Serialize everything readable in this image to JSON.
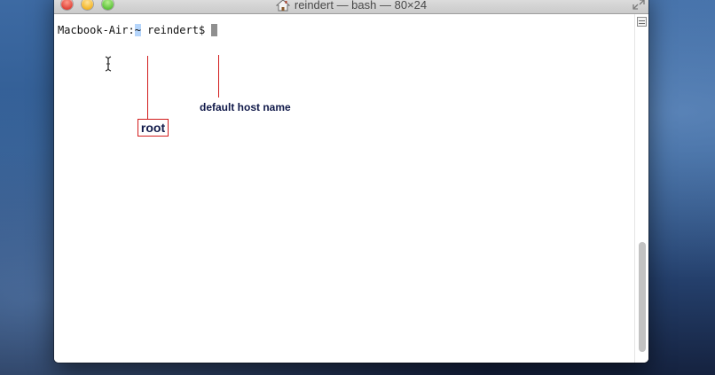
{
  "window": {
    "title": "reindert — bash — 80×24",
    "title_icon": "home-icon"
  },
  "terminal": {
    "prompt_host": "Macbook-Air:",
    "prompt_dir": "~",
    "prompt_user": " reindert$ "
  },
  "annotations": {
    "root_label": "root",
    "host_label": "default host name",
    "line_color": "#d21c1c",
    "text_color": "#111a4a"
  },
  "scrollbar": {
    "position": 1.0
  },
  "colors": {
    "selection": "#b5d5fb",
    "cursor": "#8f8f8f",
    "close": "#e0443a",
    "minimize": "#f4b628",
    "zoom": "#5ec33b"
  }
}
